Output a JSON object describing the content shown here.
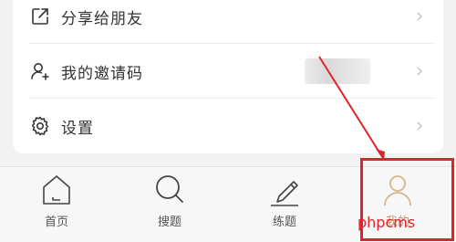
{
  "menu": {
    "items": [
      {
        "label": "分享给朋友",
        "icon": "share-icon"
      },
      {
        "label": "我的邀请码",
        "icon": "add-user-icon"
      },
      {
        "label": "设置",
        "icon": "gear-icon"
      }
    ]
  },
  "tabbar": {
    "tabs": [
      {
        "label": "首页",
        "icon": "home-icon"
      },
      {
        "label": "搜题",
        "icon": "search-icon"
      },
      {
        "label": "练题",
        "icon": "pencil-icon"
      },
      {
        "label": "我的",
        "icon": "user-icon",
        "active": true
      }
    ]
  },
  "watermark": {
    "text": "phpcms"
  },
  "colors": {
    "accent": "#c9915a",
    "annotation": "#e0242a"
  }
}
